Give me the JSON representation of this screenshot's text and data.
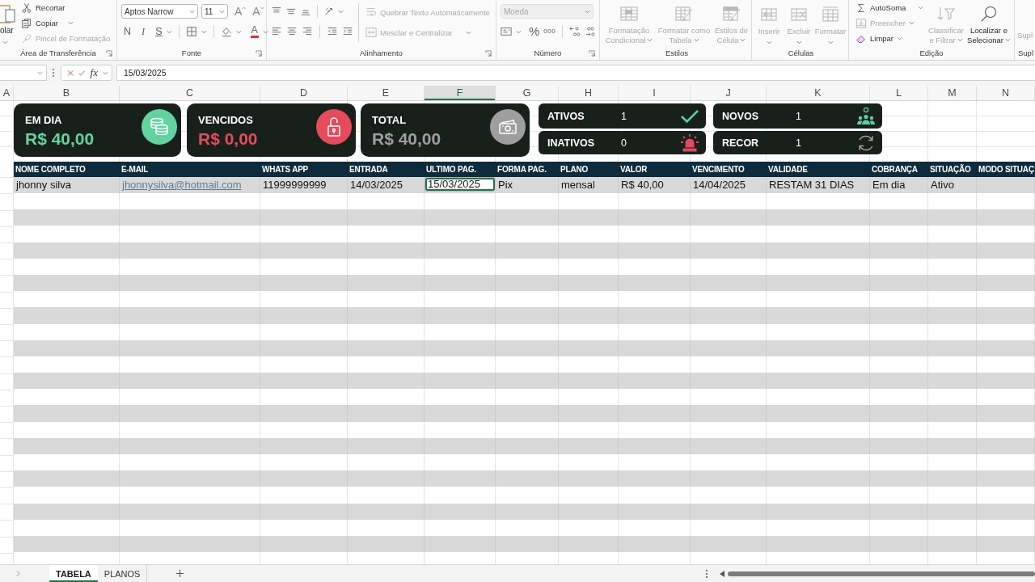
{
  "ribbon": {
    "clipboard": {
      "label": "Área de Transferência",
      "launcher": true,
      "paste": {
        "label": "olar",
        "disabled": false
      },
      "cut": {
        "label": "Recortar",
        "disabled": false
      },
      "copy": {
        "label": "Copiar",
        "disabled": false
      },
      "format_painter": {
        "label": "Pincel de Formatação",
        "disabled": true
      }
    },
    "font": {
      "label": "Fonte",
      "launcher": true,
      "font_name": "Aptos Narrow",
      "font_size": "11",
      "grow_font": "A",
      "shrink_font": "A",
      "bold": "N",
      "italic": "I",
      "underline": "S",
      "font_color": "A"
    },
    "alignment": {
      "label": "Alinhamento",
      "launcher": true,
      "wrap_text": {
        "label": "Quebrar Texto Automaticamente",
        "disabled": true
      },
      "merge": {
        "label": "Mesclar e Centralizar",
        "disabled": true
      }
    },
    "number": {
      "label": "Número",
      "launcher": true,
      "format": {
        "value": "Moeda",
        "disabled": true
      },
      "percent": "%",
      "thousands": "000"
    },
    "styles": {
      "label": "Estilos",
      "launcher": false,
      "buttons": [
        {
          "label": "Formatação Condicional",
          "disabled": true
        },
        {
          "label": "Formatar como Tabela",
          "disabled": true
        },
        {
          "label": "Estilos de Célula",
          "disabled": true
        }
      ]
    },
    "cells": {
      "label": "Células",
      "launcher": false,
      "buttons": [
        {
          "label": "Inserir",
          "disabled": true
        },
        {
          "label": "Excluir",
          "disabled": true
        },
        {
          "label": "Formatar",
          "disabled": true
        }
      ]
    },
    "editing": {
      "label": "Edição",
      "launcher": false,
      "autosum": {
        "label": "AutoSoma",
        "disabled": false
      },
      "fill": {
        "label": "Preencher",
        "disabled": true
      },
      "clear": {
        "label": "Limpar",
        "disabled": false
      },
      "sort_filter": {
        "label": "Classificar e Filtrar",
        "disabled": true
      },
      "find_select": {
        "label": "Localizar e Selecionar",
        "disabled": false
      }
    },
    "add_ins": {
      "label": "Supl",
      "button": {
        "label": "Supl",
        "disabled": true
      }
    }
  },
  "formula_bar": {
    "function_label": "fx",
    "formula": "15/03/2025"
  },
  "column_headers": [
    {
      "label": "A",
      "selected": false
    },
    {
      "label": "B",
      "selected": false
    },
    {
      "label": "C",
      "selected": false
    },
    {
      "label": "D",
      "selected": false
    },
    {
      "label": "E",
      "selected": false
    },
    {
      "label": "F",
      "selected": true
    },
    {
      "label": "G",
      "selected": false
    },
    {
      "label": "H",
      "selected": false
    },
    {
      "label": "I",
      "selected": false
    },
    {
      "label": "J",
      "selected": false
    },
    {
      "label": "K",
      "selected": false
    },
    {
      "label": "L",
      "selected": false
    },
    {
      "label": "M",
      "selected": false
    },
    {
      "label": "N",
      "selected": false
    }
  ],
  "summary_cards": [
    {
      "title": "EM DIA",
      "value": "R$ 40,00",
      "color": "#62d3a0"
    },
    {
      "title": "VENCIDOS",
      "value": "R$ 0,00",
      "color": "#e44b5c"
    },
    {
      "title": "TOTAL",
      "value": "R$ 40,00",
      "color": "#9e9e9e"
    }
  ],
  "status_columns": [
    {
      "cards": [
        {
          "label": "ATIVOS",
          "value": "1",
          "color": "#5fcf9f"
        },
        {
          "label": "INATIVOS",
          "value": "0",
          "color": "#e04a5a"
        }
      ]
    },
    {
      "cards": [
        {
          "label": "NOVOS",
          "value": "1",
          "color": "#5fcf9f"
        },
        {
          "label": "RECOR",
          "value": "1",
          "color": "#a0a0a0"
        }
      ]
    }
  ],
  "table": {
    "columns": [
      "NOME COMPLETO",
      "E-MAIL",
      "WHATS APP",
      "ENTRADA",
      "ULTIMO PAG.",
      "FORMA PAG.",
      "PLANO",
      "VALOR",
      "VENCIMENTO",
      "VALIDADE",
      "COBRANÇA",
      "SITUAÇÃO",
      "MODO SITUAÇ"
    ],
    "rows": [
      {
        "cells": [
          {
            "text": "jhonny silva",
            "kind": "text",
            "selected": false
          },
          {
            "text": "jhonnysilva@hotmail.com",
            "kind": "link",
            "selected": false
          },
          {
            "text": "11999999999",
            "kind": "text",
            "selected": false
          },
          {
            "text": "14/03/2025",
            "kind": "text",
            "selected": false
          },
          {
            "text": "15/03/2025",
            "kind": "text",
            "selected": true
          },
          {
            "text": "Pix",
            "kind": "text",
            "selected": false
          },
          {
            "text": "mensal",
            "kind": "text",
            "selected": false
          },
          {
            "text": "R$ 40,00",
            "kind": "text",
            "selected": false
          },
          {
            "text": "14/04/2025",
            "kind": "text",
            "selected": false
          },
          {
            "text": "RESTAM 31 DIAS",
            "kind": "text",
            "selected": false
          },
          {
            "text": "Em dia",
            "kind": "text",
            "selected": false
          },
          {
            "text": "Ativo",
            "kind": "text",
            "selected": false
          }
        ]
      }
    ]
  },
  "sheet_tabs": [
    {
      "label": "TABELA",
      "selected": true
    },
    {
      "label": "PLANOS",
      "selected": false
    }
  ]
}
